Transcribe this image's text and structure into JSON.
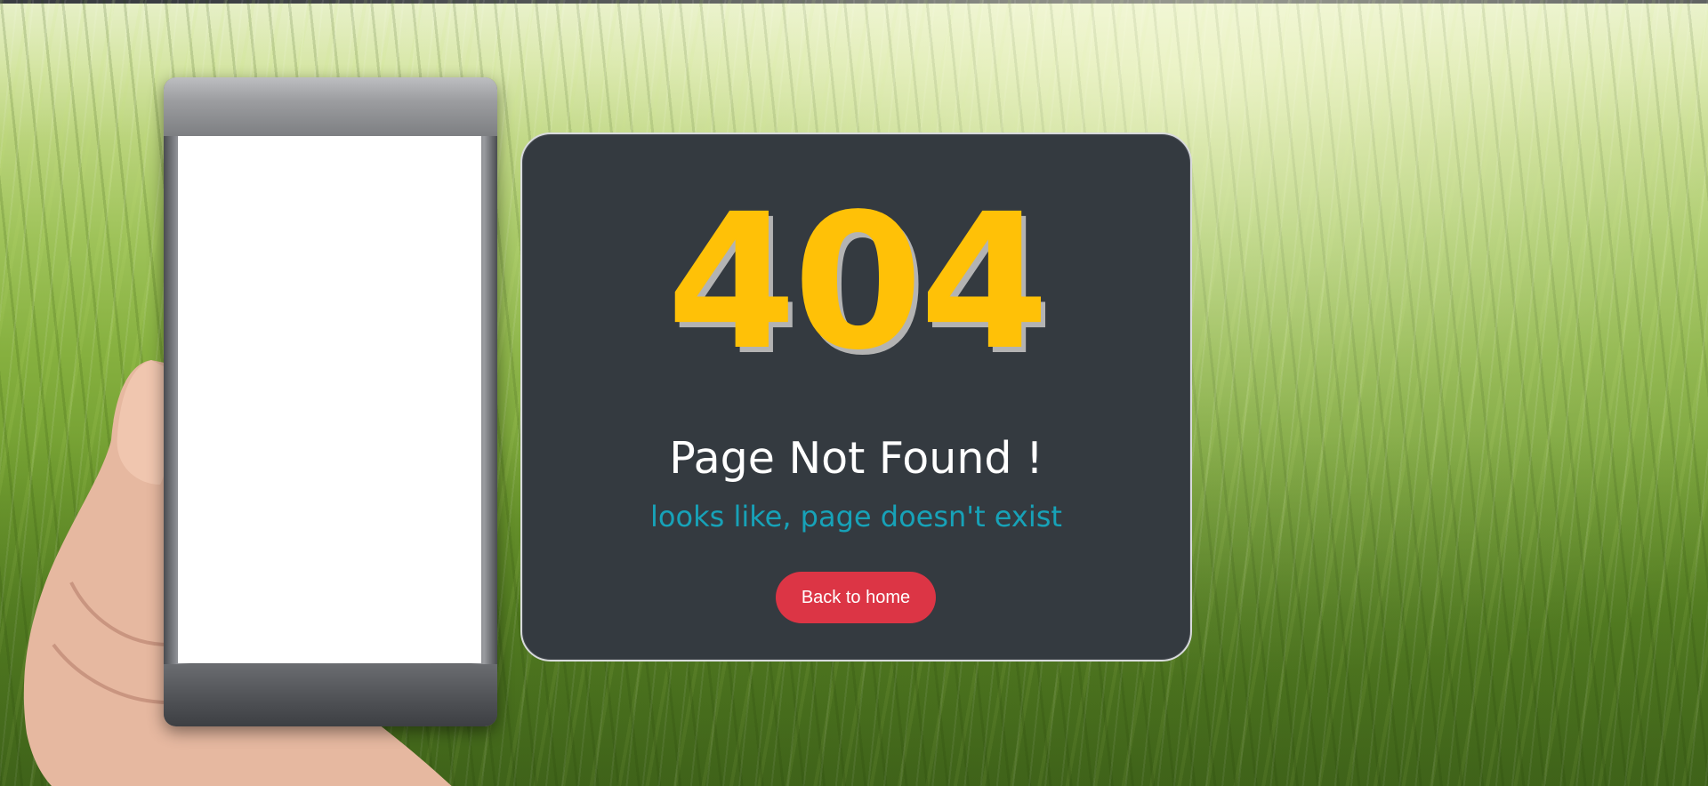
{
  "error": {
    "code": "404",
    "title": "Page Not Found !",
    "subtitle": "looks like, page doesn't exist"
  },
  "actions": {
    "back_home_label": "Back to home"
  },
  "colors": {
    "code": "#ffc107",
    "subtitle": "#17a2b8",
    "button": "#dc3545",
    "card": "#343a40"
  },
  "images": {
    "background": "wheat-field-photo",
    "illustration": "hand-holding-phone"
  }
}
